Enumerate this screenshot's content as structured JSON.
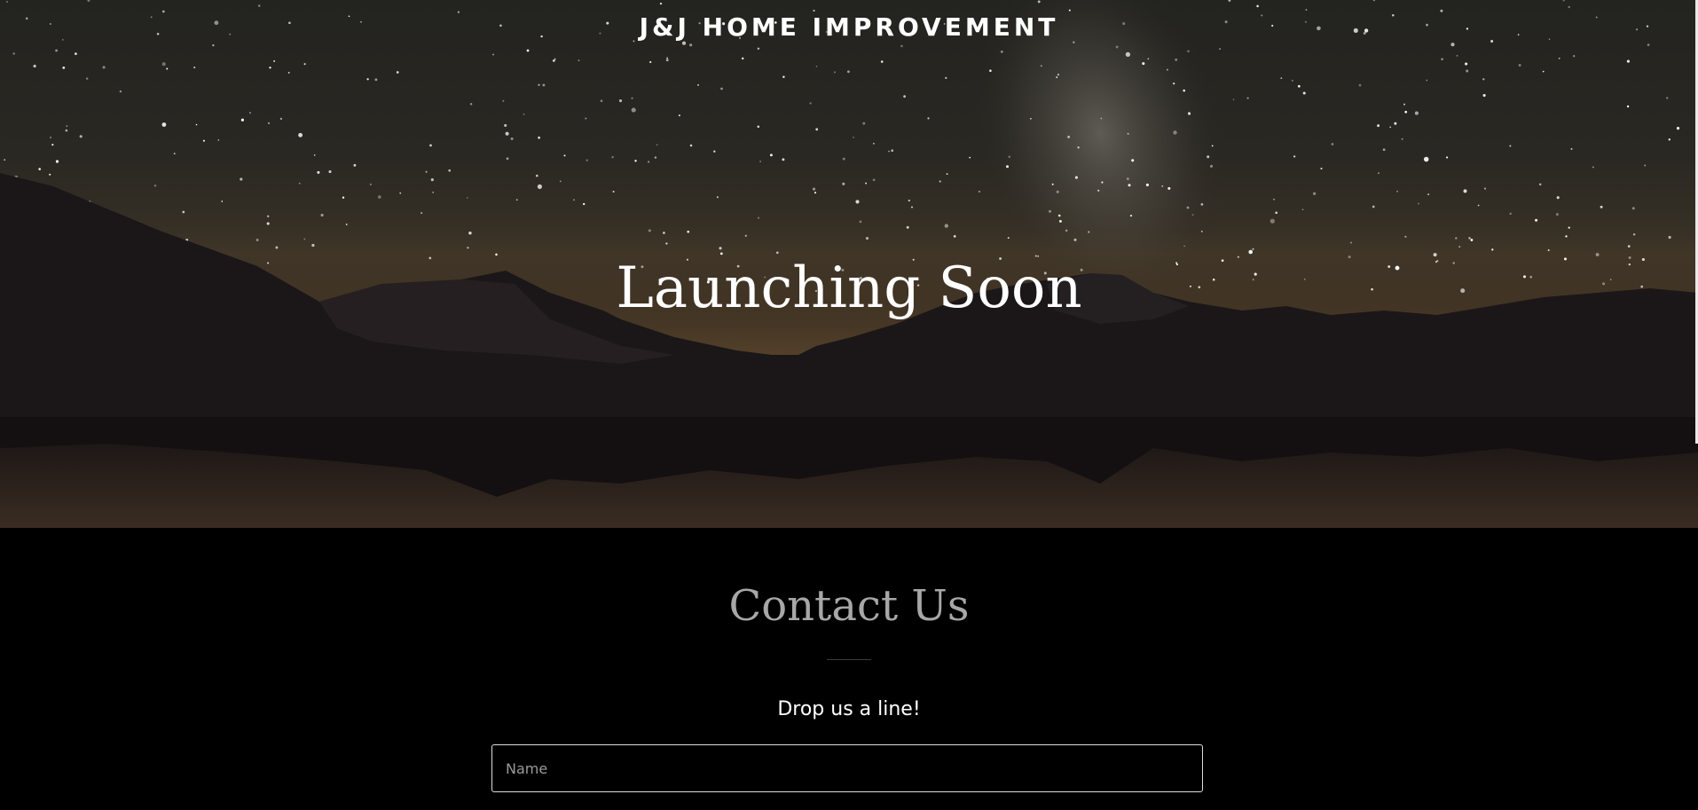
{
  "header": {
    "site_title": "J&J HOME IMPROVEMENT"
  },
  "hero": {
    "heading": "Launching Soon",
    "background": "starry-night-mountain-lake"
  },
  "contact": {
    "title": "Contact Us",
    "tagline": "Drop us a line!",
    "name_placeholder": "Name"
  },
  "colors": {
    "page_background": "#000000",
    "hero_text": "#ffffff",
    "contact_title": "#a7a7a7",
    "field_border": "#dcdcdc"
  }
}
